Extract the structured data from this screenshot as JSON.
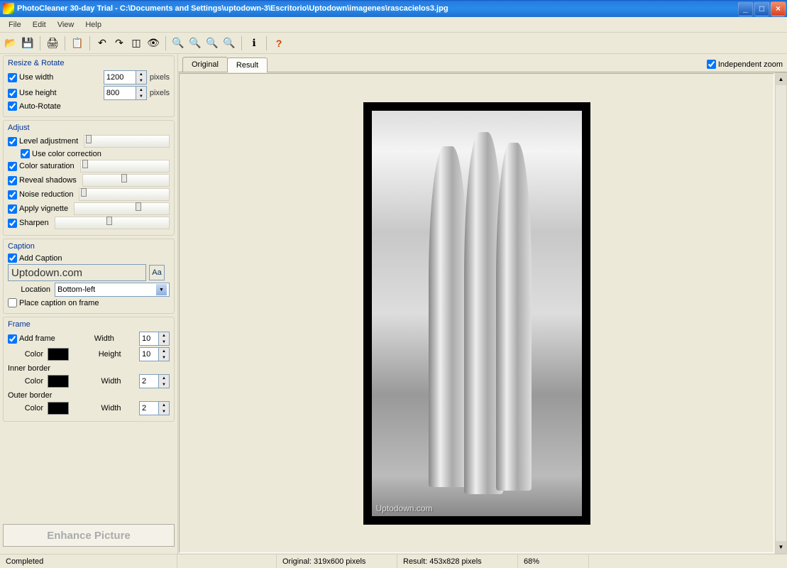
{
  "window": {
    "title": "PhotoCleaner 30-day Trial - C:\\Documents and Settings\\uptodown-3\\Escritorio\\Uptodown\\imagenes\\rascacielos3.jpg"
  },
  "menu": {
    "file": "File",
    "edit": "Edit",
    "view": "View",
    "help": "Help"
  },
  "resize": {
    "title": "Resize & Rotate",
    "use_width": "Use width",
    "width_val": "1200",
    "pixels": "pixels",
    "use_height": "Use height",
    "height_val": "800",
    "auto_rotate": "Auto-Rotate"
  },
  "adjust": {
    "title": "Adjust",
    "level": "Level adjustment",
    "color_corr": "Use color correction",
    "saturation": "Color saturation",
    "reveal": "Reveal shadows",
    "noise": "Noise reduction",
    "vignette": "Apply vignette",
    "sharpen": "Sharpen"
  },
  "caption": {
    "title": "Caption",
    "add": "Add Caption",
    "text": "Uptodown.com",
    "font_btn": "Aa",
    "location_lbl": "Location",
    "location_val": "Bottom-left",
    "on_frame": "Place caption on frame"
  },
  "frame": {
    "title": "Frame",
    "add": "Add frame",
    "width_lbl": "Width",
    "height_lbl": "Height",
    "color_lbl": "Color",
    "width_val": "10",
    "height_val": "10",
    "inner": "Inner border",
    "inner_w": "2",
    "outer": "Outer border",
    "outer_w": "2",
    "swatch": "#000000"
  },
  "enhance": "Enhance Picture",
  "tabs": {
    "original": "Original",
    "result": "Result",
    "zoom": "Independent zoom"
  },
  "watermark": "Uptodown.com",
  "status": {
    "completed": "Completed",
    "original": "Original: 319x600 pixels",
    "result": "Result: 453x828 pixels",
    "zoom": "68%"
  }
}
